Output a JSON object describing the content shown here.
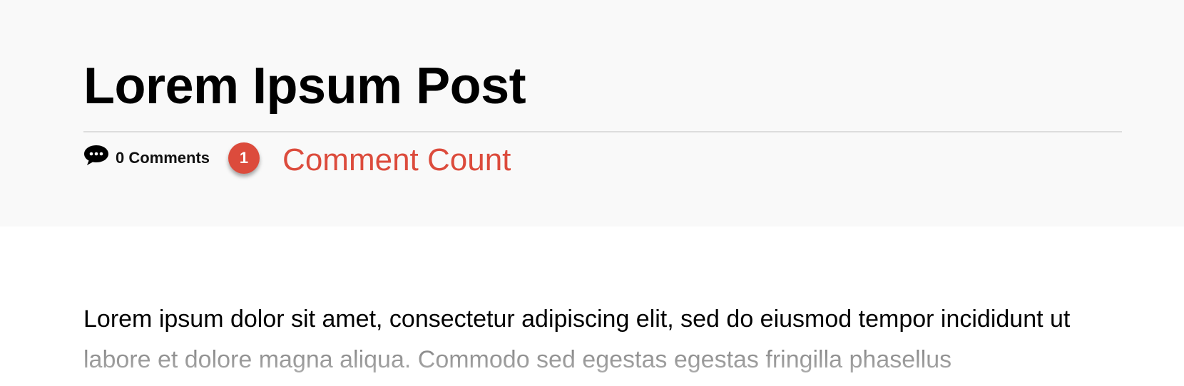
{
  "post": {
    "title": "Lorem Ipsum Post",
    "comments_label": "0 Comments",
    "badge_number": "1",
    "badge_caption": "Comment Count",
    "body_excerpt": "Lorem ipsum dolor sit amet, consectetur adipiscing elit, sed do eiusmod tempor incididunt ut labore et dolore magna aliqua. Commodo sed egestas egestas fringilla phasellus"
  },
  "icons": {
    "comments": "speech-bubble-icon"
  },
  "colors": {
    "header_background": "#f9f9f9",
    "accent": "#dc4b3c",
    "title": "#000000"
  }
}
